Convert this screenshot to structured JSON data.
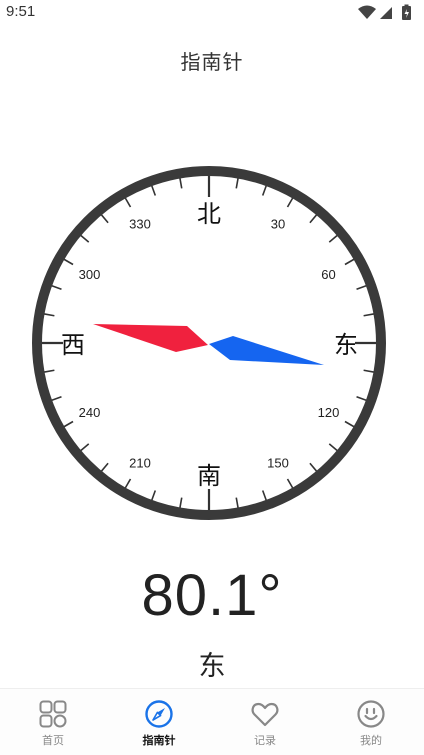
{
  "status_bar": {
    "time": "9:51",
    "icons": [
      "wifi-icon",
      "cell-signal-icon",
      "battery-icon"
    ]
  },
  "header": {
    "title": "指南针"
  },
  "compass": {
    "heading_degrees": 80.1,
    "cardinals": {
      "north": "北",
      "east": "东",
      "south": "南",
      "west": "西"
    },
    "degree_labels": [
      "30",
      "60",
      "120",
      "150",
      "210",
      "240",
      "300",
      "330"
    ],
    "colors": {
      "ring": "#3a3a3a",
      "needle_north": "#f0213e",
      "needle_south": "#1565f0"
    }
  },
  "reading": {
    "value": "80.1°",
    "direction": "东"
  },
  "nav": {
    "items": [
      {
        "label": "首页",
        "icon": "grid-home-icon",
        "active": false
      },
      {
        "label": "指南针",
        "icon": "compass-icon",
        "active": true
      },
      {
        "label": "记录",
        "icon": "heart-icon",
        "active": false
      },
      {
        "label": "我的",
        "icon": "smiley-profile-icon",
        "active": false
      }
    ],
    "active_color": "#1a73e8",
    "inactive_color": "#888888"
  }
}
